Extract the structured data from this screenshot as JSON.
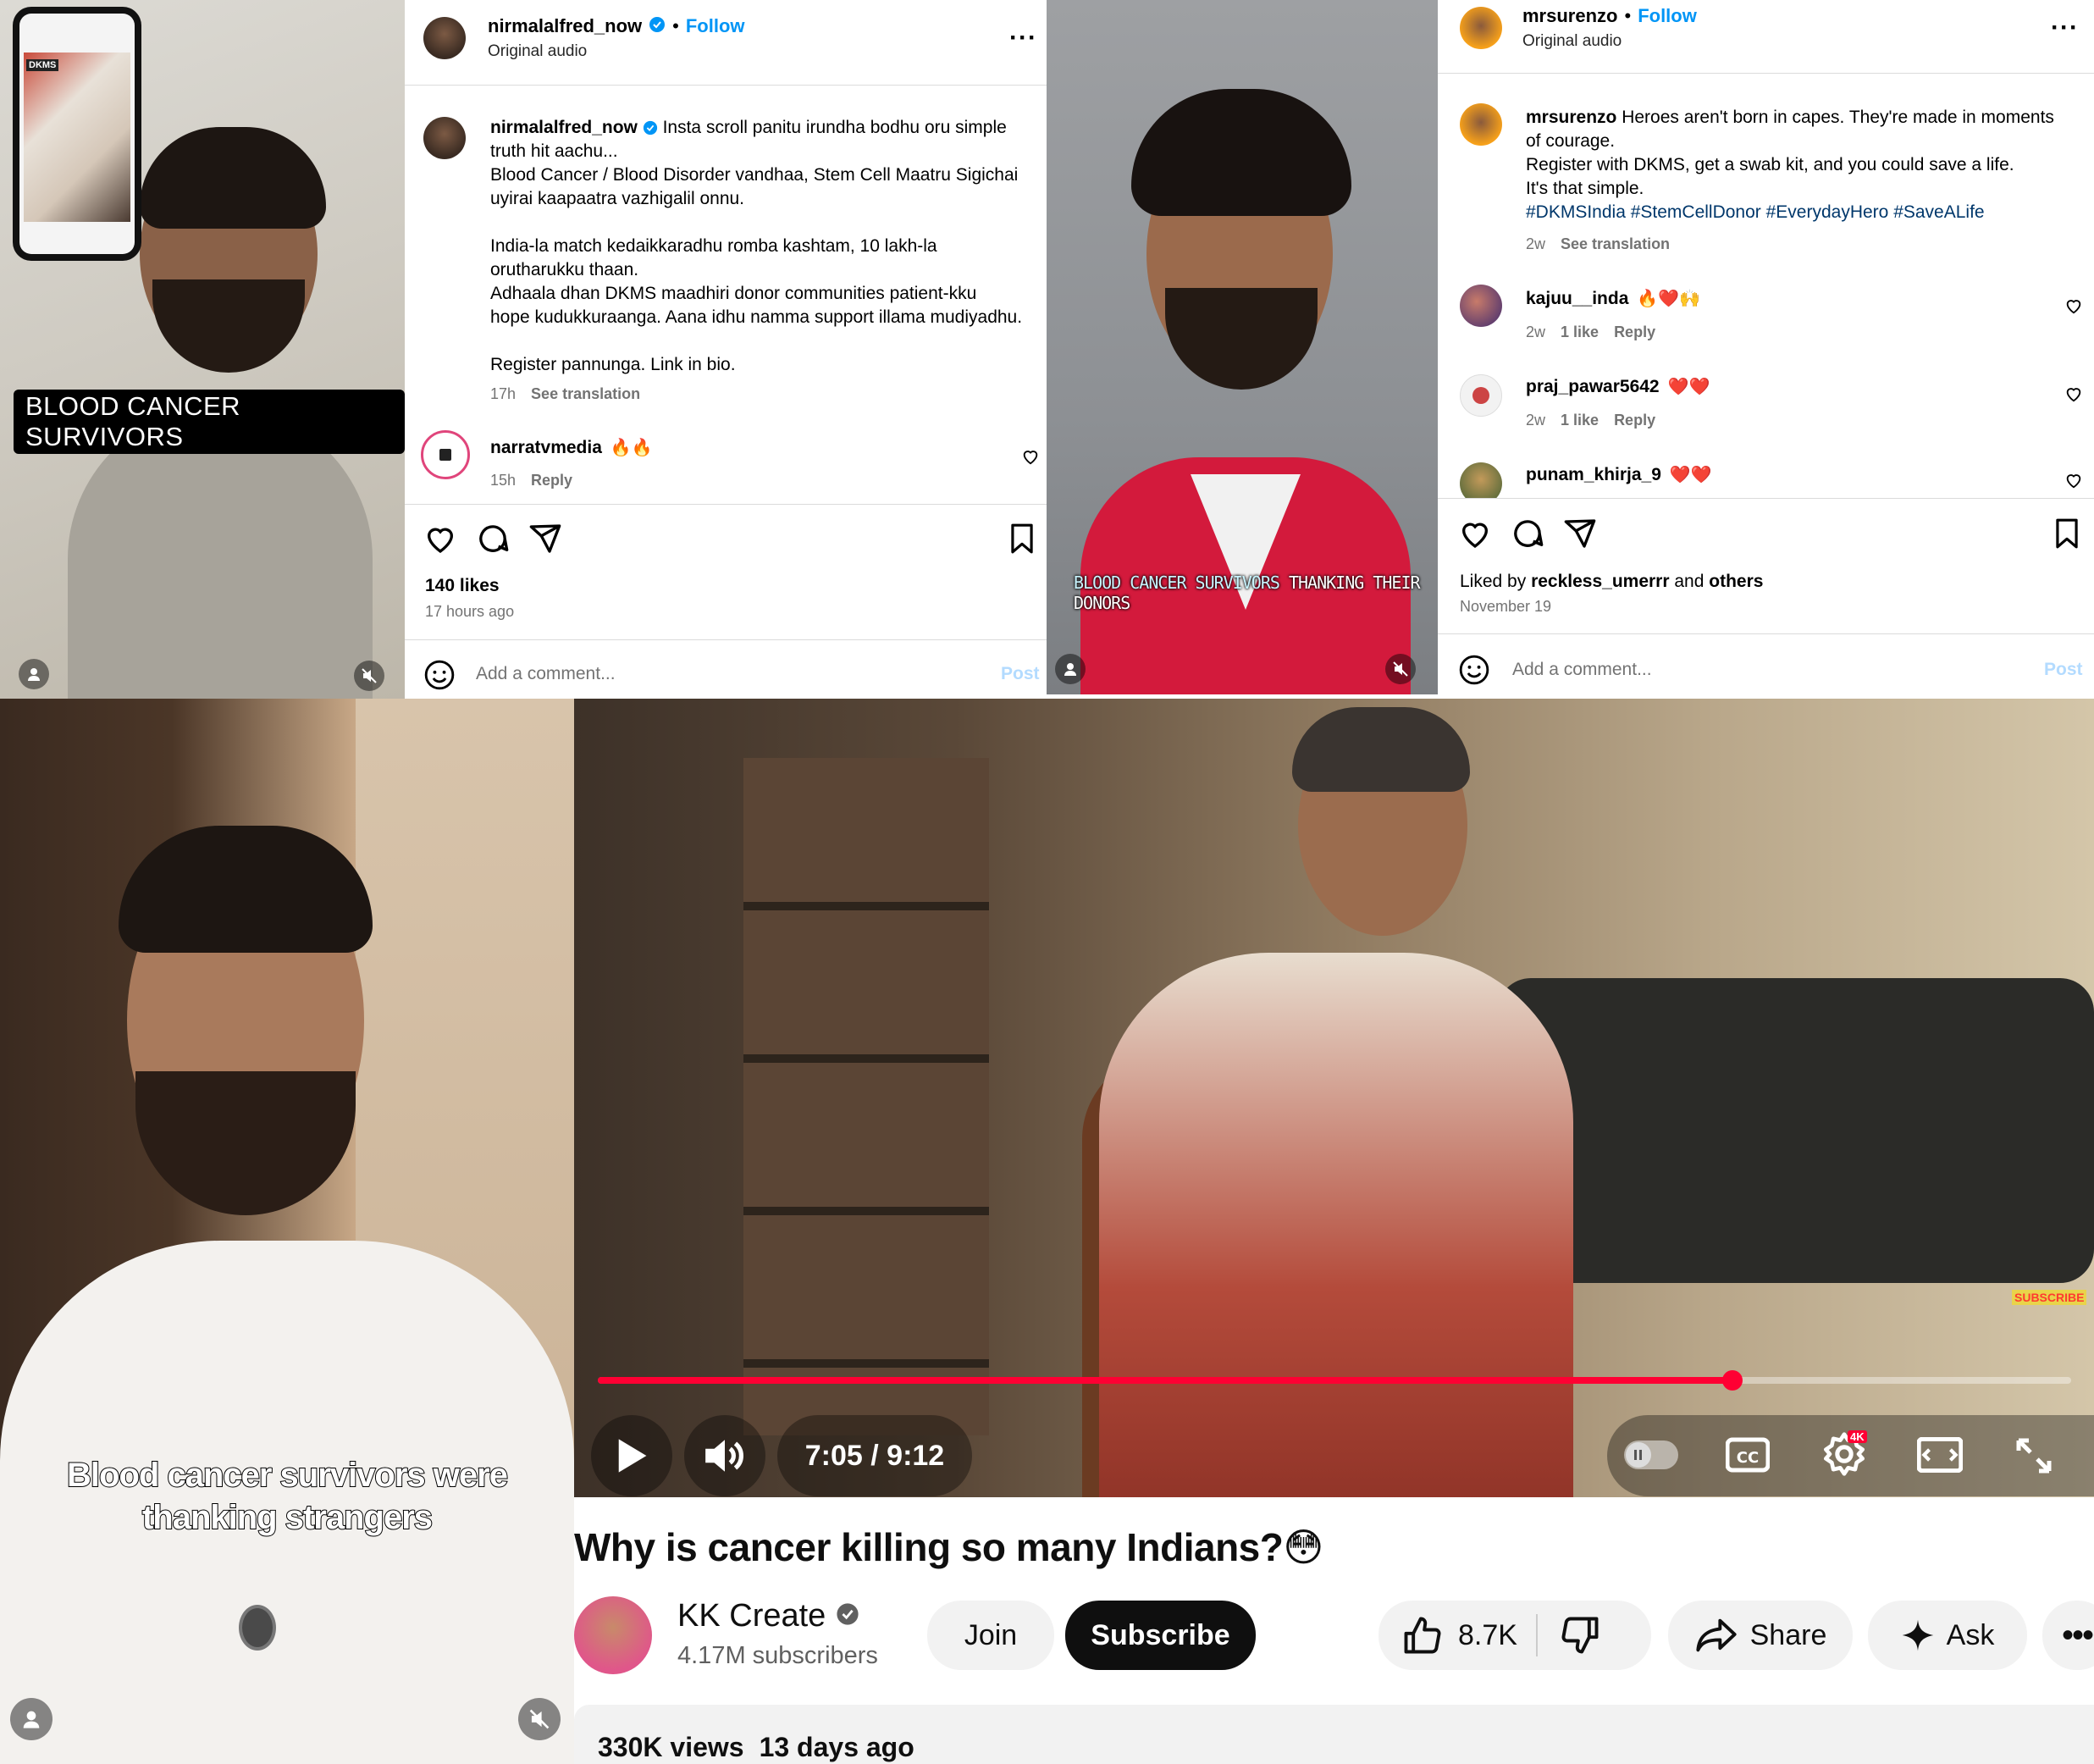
{
  "panel1": {
    "caption": "BLOOD CANCER SURVIVORS",
    "phone_logo": "DKMS"
  },
  "post1": {
    "username": "nirmalalfred_now",
    "follow": "Follow",
    "audio": "Original audio",
    "caption_lines": [
      "Insta scroll panitu irundha bodhu oru simple",
      "truth hit aachu...",
      "Blood Cancer / Blood Disorder vandhaa, Stem Cell Maatru Sigichai",
      "uyirai kaapaatra vazhigalil onnu.",
      "",
      "India-la match kedaikkaradhu romba kashtam, 10 lakh-la",
      "orutharukku thaan.",
      "Adhaala dhan DKMS maadhiri donor communities patient-kku",
      "hope kudukkuraanga. Aana idhu namma support illama mudiyadhu.",
      "",
      "Register pannunga. Link in bio."
    ],
    "caption_time": "17h",
    "see_translation": "See translation",
    "comment": {
      "username": "narratvmedia",
      "text": "🔥🔥",
      "time": "15h",
      "reply": "Reply"
    },
    "likes": "140 likes",
    "posted": "17 hours ago",
    "add_comment": "Add a comment...",
    "post_btn": "Post"
  },
  "panel3": {
    "caption_a": "BLOOD CANCER SURVIVORS",
    "caption_b": "THANKING THEIR DONORS"
  },
  "post2": {
    "username": "mrsurenzo",
    "follow": "Follow",
    "audio": "Original audio",
    "caption_lines": [
      "Heroes aren't born in capes. They're made in moments",
      "of courage.",
      "Register with DKMS, get a swab kit, and you could save a life.",
      "It's that simple."
    ],
    "hashtags": "#DKMSIndia #StemCellDonor #EverydayHero #SaveALife",
    "caption_time": "2w",
    "see_translation": "See translation",
    "comments": [
      {
        "username": "kajuu__inda",
        "text": "🔥❤️🙌",
        "time": "2w",
        "likes": "1 like",
        "reply": "Reply"
      },
      {
        "username": "praj_pawar5642",
        "text": "❤️❤️",
        "time": "2w",
        "likes": "1 like",
        "reply": "Reply"
      },
      {
        "username": "punam_khirja_9",
        "text": "❤️❤️",
        "time": "",
        "likes": "",
        "reply": ""
      }
    ],
    "liked_by_prefix": "Liked by",
    "liked_by_user": "reckless_umerrr",
    "liked_by_and": "and",
    "liked_by_others": "others",
    "date": "November 19",
    "add_comment": "Add a comment...",
    "post_btn": "Post"
  },
  "panel5": {
    "subtitle_line1": "Blood cancer survivors were",
    "subtitle_line2": "thanking strangers"
  },
  "youtube": {
    "time": "7:05 / 9:12",
    "progress_fraction": 0.77,
    "subscribe_watermark": "SUBSCRIBE",
    "title": "Why is cancer killing so many Indians?😳",
    "channel": "KK Create",
    "subscribers": "4.17M subscribers",
    "join": "Join",
    "subscribe": "Subscribe",
    "likes": "8.7K",
    "share": "Share",
    "ask": "Ask",
    "views": "330K views",
    "age": "13 days ago",
    "badge_4k": "4K",
    "accent": "#ff0033"
  }
}
